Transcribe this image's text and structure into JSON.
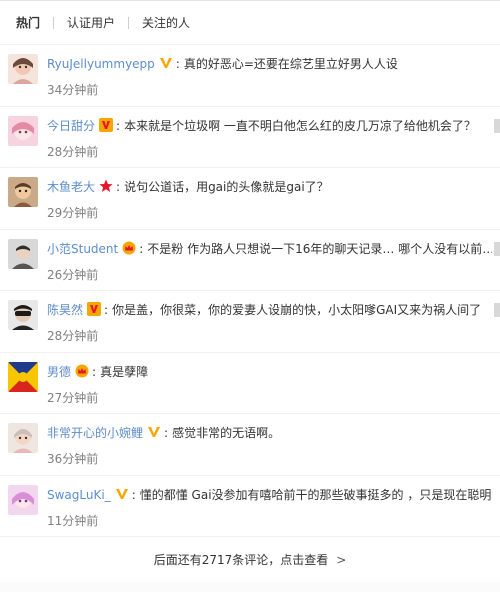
{
  "tabs": [
    {
      "label": "热门",
      "active": true
    },
    {
      "label": "认证用户",
      "active": false
    },
    {
      "label": "关注的人",
      "active": false
    }
  ],
  "comments": [
    {
      "user": "RyuJellyummyepp",
      "badge": "v-icon",
      "text": "真的好恶心=还要在综艺里立好男人人设",
      "time": "34分钟前"
    },
    {
      "user": "今日甜分",
      "badge": "vip-icon",
      "text": "本来就是个垃圾啊 一直不明白他怎么红的皮几万凉了给他机会了？",
      "time": "28分钟前"
    },
    {
      "user": "木鱼老大",
      "badge": "star-icon",
      "text": "说句公道话，用gai的头像就是gai了？",
      "time": "29分钟前"
    },
    {
      "user": "小范Student",
      "badge": "crown-icon",
      "text": "不是粉 作为路人只想说一下16年的聊天记录… 哪个人没有以前…",
      "time": "26分钟前"
    },
    {
      "user": "陈昊然",
      "badge": "vip-icon",
      "text": "你是盖，你很菜，你的爱妻人设崩的快，小太阳嗲GAI又来为祸人间了",
      "time": "28分钟前"
    },
    {
      "user": "男德",
      "badge": "crown-icon",
      "text": "真是孽障",
      "time": "27分钟前"
    },
    {
      "user": "非常开心的小婉鲤",
      "badge": "v-icon",
      "text": "感觉非常的无语啊。",
      "time": "36分钟前"
    },
    {
      "user": "SwagLuKi_",
      "badge": "v-icon",
      "text": "懂的都懂 Gai没参加有嘻哈前干的那些破事挺多的 ，只是现在聪明",
      "time": "11分钟前"
    }
  ],
  "footer": {
    "more_label": "后面还有2717条评论，点击查看",
    "chevron": ">"
  },
  "colors": {
    "name_orange": "#eb7350",
    "name_blue": "#5d8dcc",
    "time_gray": "#808080",
    "badge_gold": "#f7a600",
    "badge_red": "#e6162d"
  }
}
